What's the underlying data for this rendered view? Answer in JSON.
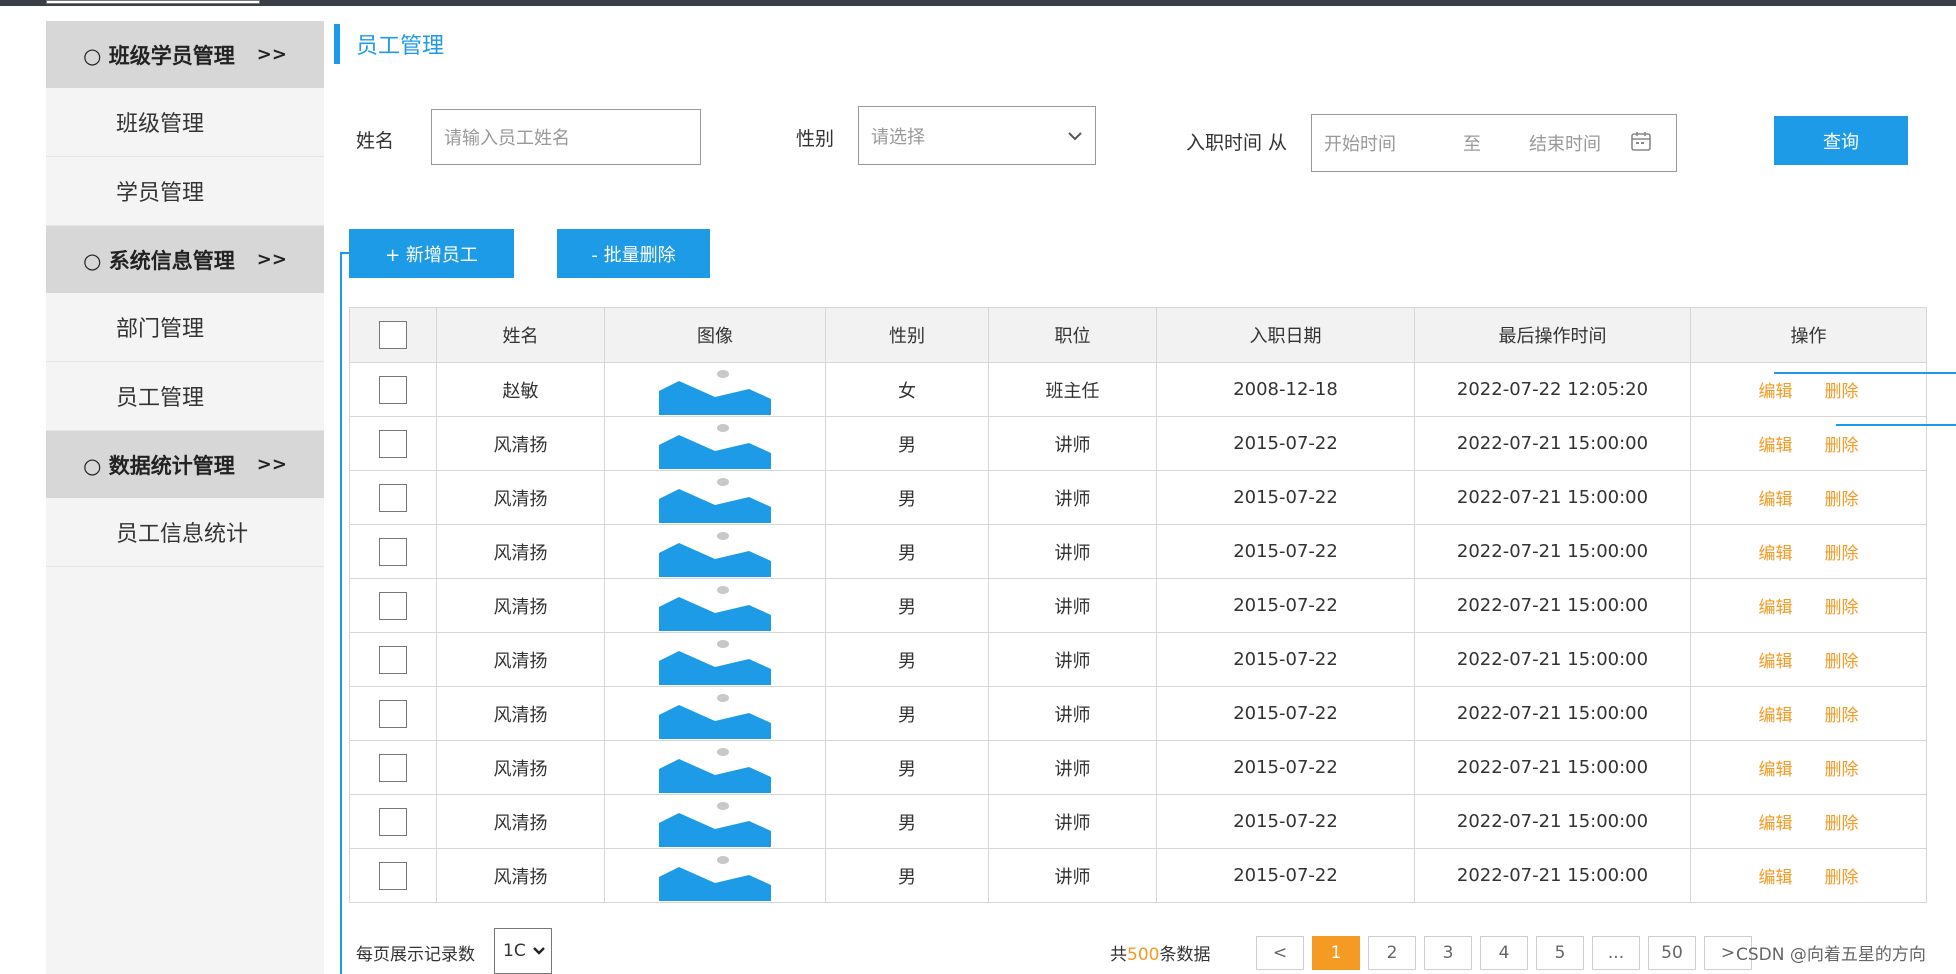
{
  "sidebar": {
    "groups": [
      {
        "label": "○ 班级学员管理",
        "arrows": ">>",
        "items": [
          "班级管理",
          "学员管理"
        ]
      },
      {
        "label": "○ 系统信息管理",
        "arrows": ">>",
        "items": [
          "部门管理",
          "员工管理"
        ]
      },
      {
        "label": "○ 数据统计管理",
        "arrows": ">>",
        "items": [
          "员工信息统计"
        ]
      }
    ]
  },
  "page": {
    "title": "员工管理"
  },
  "search": {
    "name_label": "姓名",
    "name_placeholder": "请输入员工姓名",
    "gender_label": "性别",
    "gender_placeholder": "请选择",
    "date_label": "入职时间 从",
    "start_placeholder": "开始时间",
    "to_text": "至",
    "end_placeholder": "结束时间",
    "query_button": "查询"
  },
  "toolbar": {
    "add_button": "+ 新增员工",
    "batch_delete_button": "- 批量删除"
  },
  "table": {
    "columns": [
      "姓名",
      "图像",
      "性别",
      "职位",
      "入职日期",
      "最后操作时间",
      "操作"
    ],
    "edit_label": "编辑",
    "delete_label": "删除",
    "rows": [
      {
        "name": "赵敏",
        "gender": "女",
        "position": "班主任",
        "hire_date": "2008-12-18",
        "last_op": "2022-07-22 12:05:20"
      },
      {
        "name": "风清扬",
        "gender": "男",
        "position": "讲师",
        "hire_date": "2015-07-22",
        "last_op": "2022-07-21 15:00:00"
      },
      {
        "name": "风清扬",
        "gender": "男",
        "position": "讲师",
        "hire_date": "2015-07-22",
        "last_op": "2022-07-21 15:00:00"
      },
      {
        "name": "风清扬",
        "gender": "男",
        "position": "讲师",
        "hire_date": "2015-07-22",
        "last_op": "2022-07-21 15:00:00"
      },
      {
        "name": "风清扬",
        "gender": "男",
        "position": "讲师",
        "hire_date": "2015-07-22",
        "last_op": "2022-07-21 15:00:00"
      },
      {
        "name": "风清扬",
        "gender": "男",
        "position": "讲师",
        "hire_date": "2015-07-22",
        "last_op": "2022-07-21 15:00:00"
      },
      {
        "name": "风清扬",
        "gender": "男",
        "position": "讲师",
        "hire_date": "2015-07-22",
        "last_op": "2022-07-21 15:00:00"
      },
      {
        "name": "风清扬",
        "gender": "男",
        "position": "讲师",
        "hire_date": "2015-07-22",
        "last_op": "2022-07-21 15:00:00"
      },
      {
        "name": "风清扬",
        "gender": "男",
        "position": "讲师",
        "hire_date": "2015-07-22",
        "last_op": "2022-07-21 15:00:00"
      },
      {
        "name": "风清扬",
        "gender": "男",
        "position": "讲师",
        "hire_date": "2015-07-22",
        "last_op": "2022-07-21 15:00:00"
      }
    ]
  },
  "footer": {
    "page_size_label": "每页展示记录数",
    "page_size_value": "1C",
    "total_prefix": "共",
    "total_count": "500",
    "total_suffix": "条数据",
    "pages": [
      "<",
      "1",
      "2",
      "3",
      "4",
      "5",
      "...",
      "50",
      ">"
    ],
    "active_page": "1",
    "watermark": "CSDN @向着五星的方向"
  },
  "colors": {
    "accent": "#1e9be6",
    "warning": "#f59a23",
    "sidebar_group": "#d7d7d7"
  }
}
